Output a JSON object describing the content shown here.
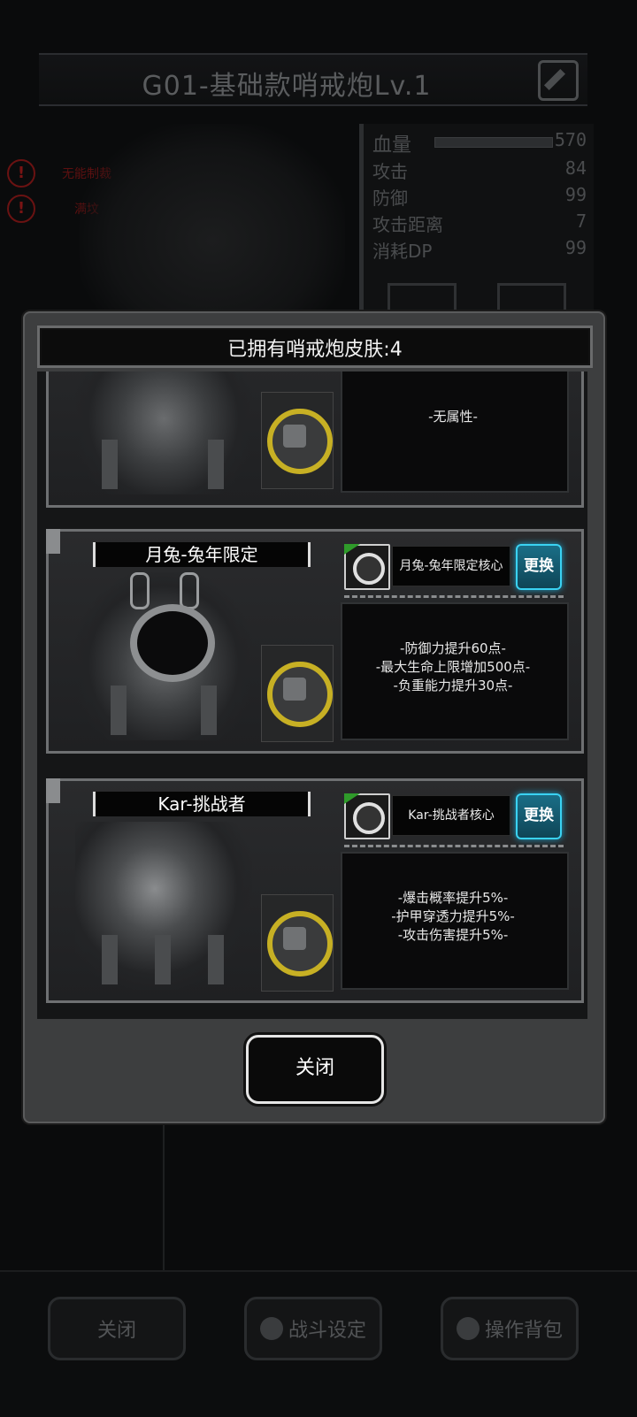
{
  "background": {
    "title": "G01-基础款哨戒炮Lv.1",
    "warnings": [
      "无能制裁",
      "满坟"
    ],
    "stats": [
      {
        "label": "血量",
        "value": "570"
      },
      {
        "label": "攻击",
        "value": "84"
      },
      {
        "label": "防御",
        "value": "99"
      },
      {
        "label": "攻击距离",
        "value": "7"
      },
      {
        "label": "消耗DP",
        "value": "99"
      }
    ],
    "bottom_buttons": {
      "close": "关闭",
      "battle_settings": "战斗设定",
      "backpack": "操作背包"
    }
  },
  "modal": {
    "title": "已拥有哨戒炮皮肤:4",
    "cards": [
      {
        "name": "",
        "core_name": "",
        "swap": "",
        "effects": [
          "-无属性-"
        ]
      },
      {
        "name": "月兔-兔年限定",
        "core_name": "月兔-兔年限定核心",
        "swap": "更换",
        "effects": [
          "-防御力提升60点-",
          "-最大生命上限增加500点-",
          "-负重能力提升30点-"
        ]
      },
      {
        "name": "Kar-挑战者",
        "core_name": "Kar-挑战者核心",
        "swap": "更换",
        "effects": [
          "-爆击概率提升5%-",
          "-护甲穿透力提升5%-",
          "-攻击伤害提升5%-"
        ]
      }
    ],
    "close_label": "关闭"
  },
  "colors": {
    "accent_swap": "#3ad2f2",
    "warning_red": "#7a1414",
    "gold_ring": "#c7b024"
  },
  "icons": [
    "edit-icon",
    "warning-icon",
    "wrench-icon",
    "search-icon",
    "gear-icon",
    "backpack-icon",
    "core-icon"
  ]
}
